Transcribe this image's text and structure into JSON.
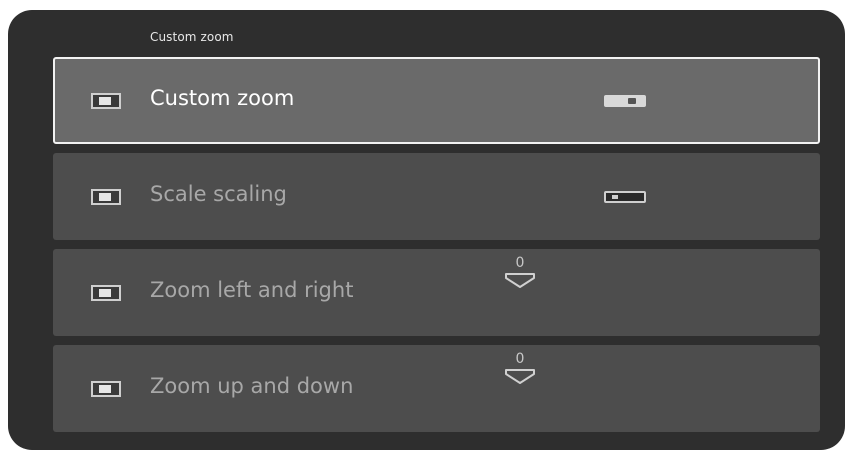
{
  "panel": {
    "title": "Custom zoom"
  },
  "rows": [
    {
      "label": "Custom zoom",
      "control": "toggle",
      "state": "on",
      "selected": true
    },
    {
      "label": "Scale scaling",
      "control": "toggle",
      "state": "off",
      "selected": false
    },
    {
      "label": "Zoom left and right",
      "control": "stepper",
      "value": "0",
      "selected": false
    },
    {
      "label": "Zoom up and down",
      "control": "stepper",
      "value": "0",
      "selected": false
    }
  ],
  "icons": {
    "row_icon": "screen-icon",
    "stepper_arrow": "chevron-down-icon"
  },
  "colors": {
    "panel_bg": "#2e2e2e",
    "row_bg": "#4d4d4d",
    "row_selected_bg": "#6a6a6a",
    "selected_border": "#f2f2f2"
  }
}
